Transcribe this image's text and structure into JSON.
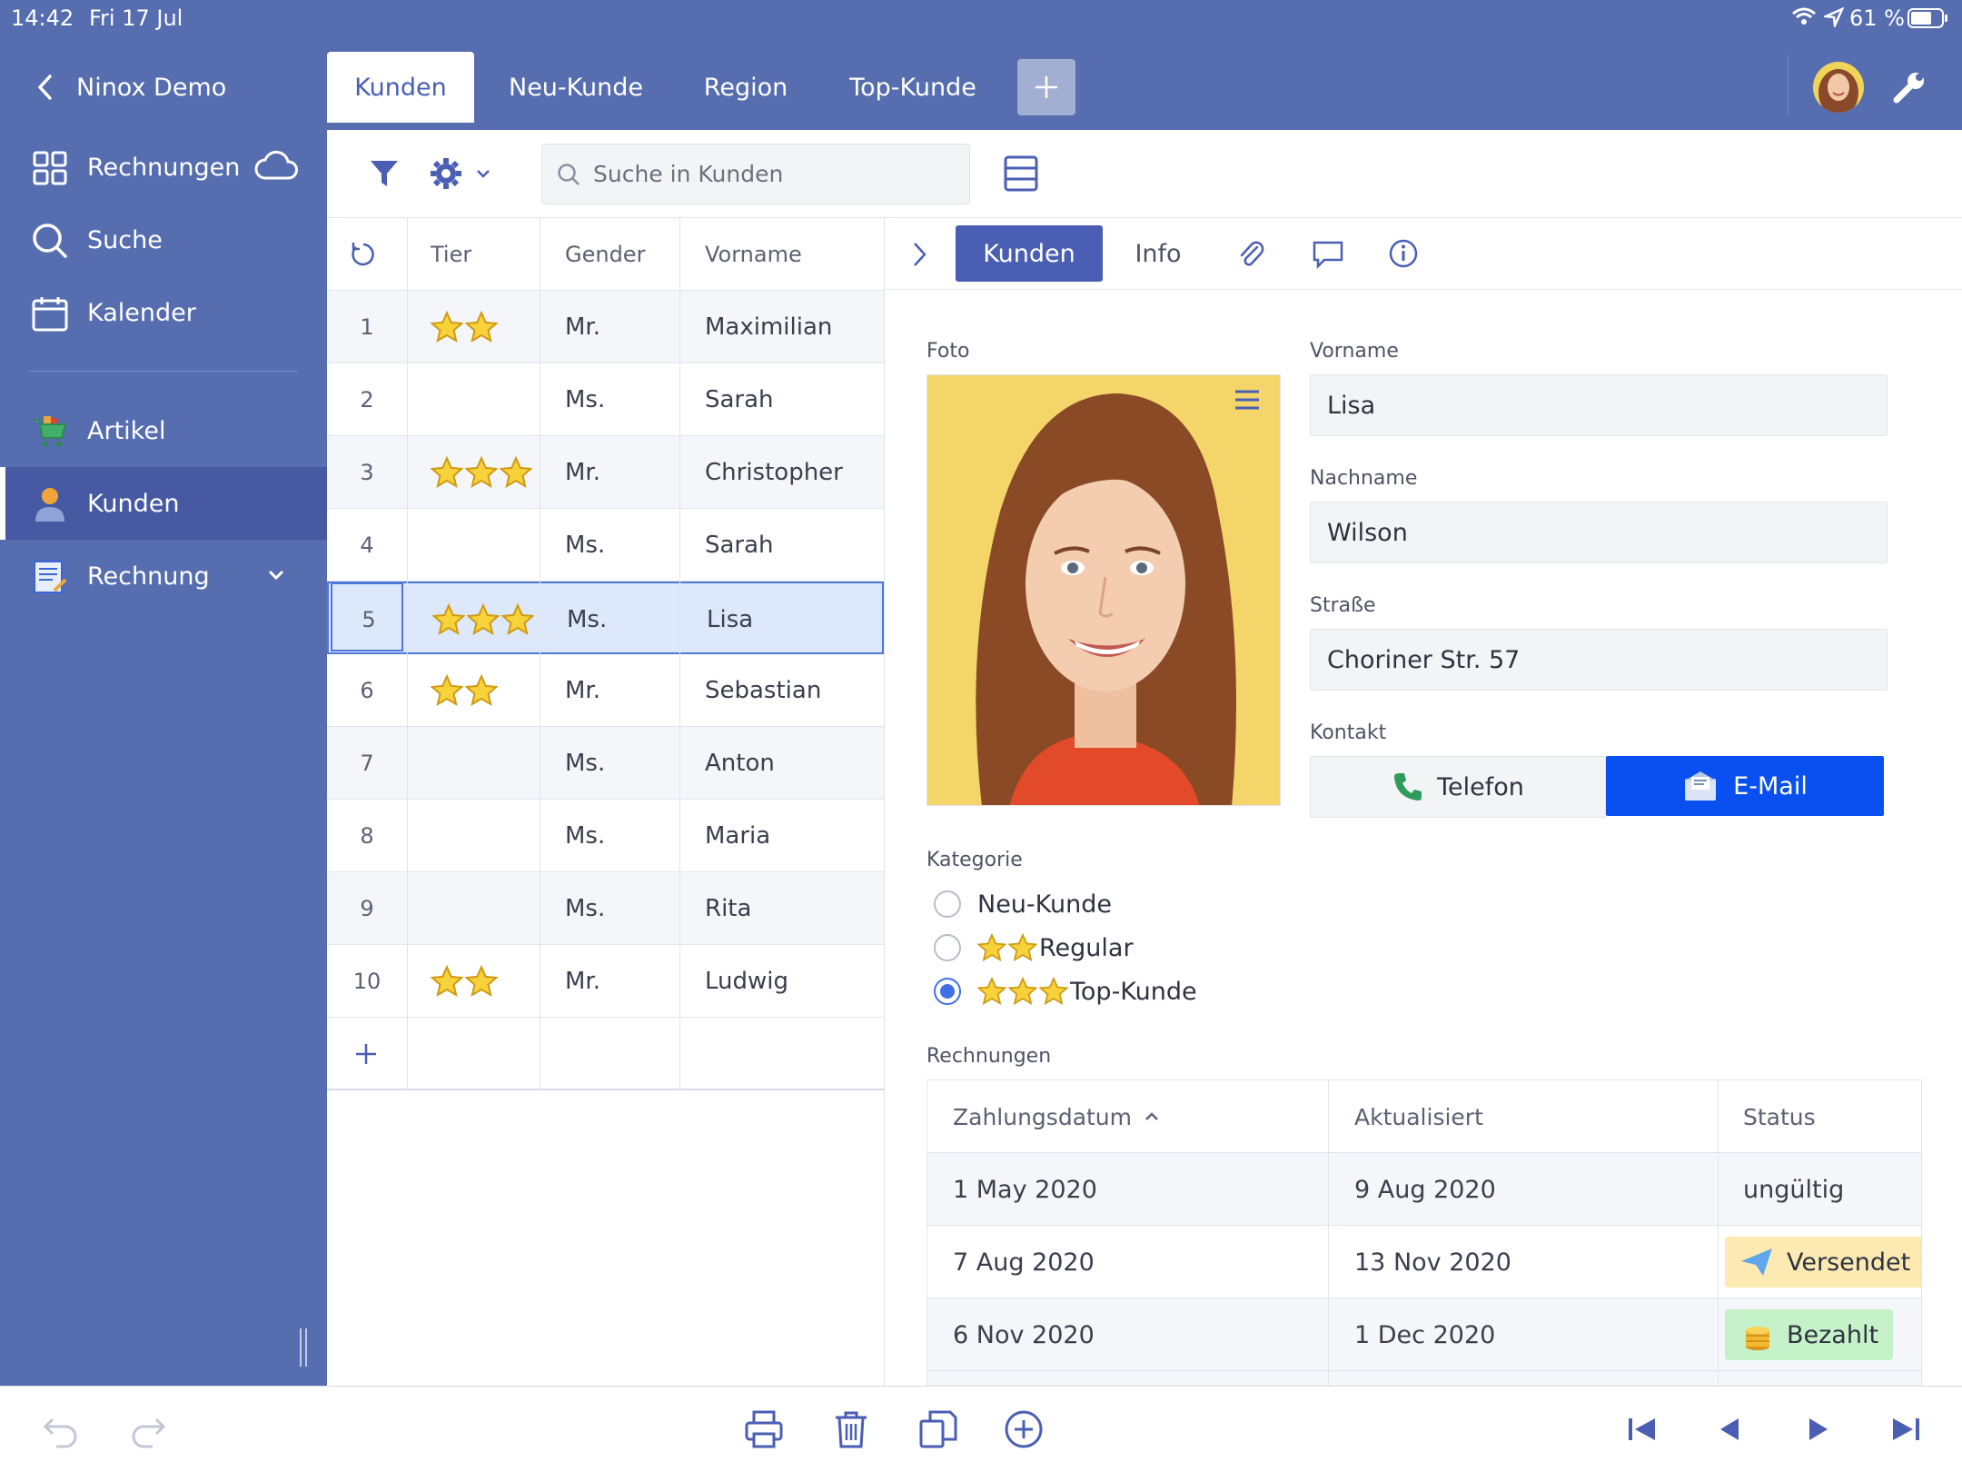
{
  "status_bar": {
    "time": "14:42",
    "date": "Fri 17 Jul",
    "battery": "61 %"
  },
  "top_nav": {
    "back_label": "Ninox Demo",
    "tabs": [
      {
        "label": "Kunden",
        "active": true
      },
      {
        "label": "Neu-Kunde",
        "active": false
      },
      {
        "label": "Region",
        "active": false
      },
      {
        "label": "Top-Kunde",
        "active": false
      }
    ],
    "add_tab_icon": "plus-icon"
  },
  "sidebar": {
    "items": [
      {
        "label": "Rechnungen",
        "icon": "grid-icon"
      },
      {
        "label": "Suche",
        "icon": "search-icon"
      },
      {
        "label": "Kalender",
        "icon": "calendar-icon"
      },
      {
        "label": "Artikel",
        "icon": "cart-icon"
      },
      {
        "label": "Kunden",
        "icon": "person-icon",
        "active": true
      },
      {
        "label": "Rechnung",
        "icon": "invoice-icon"
      }
    ]
  },
  "toolbar": {
    "search_placeholder": "Suche in Kunden"
  },
  "table": {
    "headers": [
      "Tier",
      "Gender",
      "Vorname"
    ],
    "rows": [
      {
        "num": "1",
        "stars": 2,
        "gender": "Mr.",
        "vorname": "Maximilian"
      },
      {
        "num": "2",
        "stars": 0,
        "gender": "Ms.",
        "vorname": "Sarah"
      },
      {
        "num": "3",
        "stars": 3,
        "gender": "Mr.",
        "vorname": "Christopher"
      },
      {
        "num": "4",
        "stars": 0,
        "gender": "Ms.",
        "vorname": "Sarah"
      },
      {
        "num": "5",
        "stars": 3,
        "gender": "Ms.",
        "vorname": "Lisa",
        "selected": true
      },
      {
        "num": "6",
        "stars": 2,
        "gender": "Mr.",
        "vorname": "Sebastian"
      },
      {
        "num": "7",
        "stars": 0,
        "gender": "Ms.",
        "vorname": "Anton"
      },
      {
        "num": "8",
        "stars": 0,
        "gender": "Ms.",
        "vorname": "Maria"
      },
      {
        "num": "9",
        "stars": 0,
        "gender": "Ms.",
        "vorname": "Rita"
      },
      {
        "num": "10",
        "stars": 2,
        "gender": "Mr.",
        "vorname": "Ludwig"
      }
    ]
  },
  "detail": {
    "tabs": {
      "kunden": "Kunden",
      "info": "Info"
    },
    "foto_label": "Foto",
    "vorname_label": "Vorname",
    "vorname": "Lisa",
    "nachname_label": "Nachname",
    "nachname": "Wilson",
    "strasse_label": "Straße",
    "strasse": "Choriner Str. 57",
    "kontakt_label": "Kontakt",
    "telefon": "Telefon",
    "email": "E-Mail",
    "kategorie_label": "Kategorie",
    "kategorie_options": [
      {
        "label": "Neu-Kunde",
        "stars": 0,
        "selected": false
      },
      {
        "label": "Regular",
        "stars": 2,
        "selected": false
      },
      {
        "label": "Top-Kunde",
        "stars": 3,
        "selected": true
      }
    ],
    "rechnungen_label": "Rechnungen",
    "rechnungen": {
      "headers": [
        "Zahlungsdatum",
        "Aktualisiert",
        "Status"
      ],
      "rows": [
        {
          "zahlungsdatum": "1 May 2020",
          "aktualisiert": "9 Aug 2020",
          "status": "ungültig"
        },
        {
          "zahlungsdatum": "7 Aug 2020",
          "aktualisiert": "13 Nov 2020",
          "status": "Versendet"
        },
        {
          "zahlungsdatum": "6 Nov 2020",
          "aktualisiert": "1 Dec 2020",
          "status": "Bezahlt"
        }
      ]
    }
  },
  "colors": {
    "brand": "#566db0",
    "accent": "#4a5fb4",
    "email_button": "#0a4ff0",
    "versendet_badge": "#fdeab2",
    "bezahlt_badge": "#c6f2c9"
  }
}
